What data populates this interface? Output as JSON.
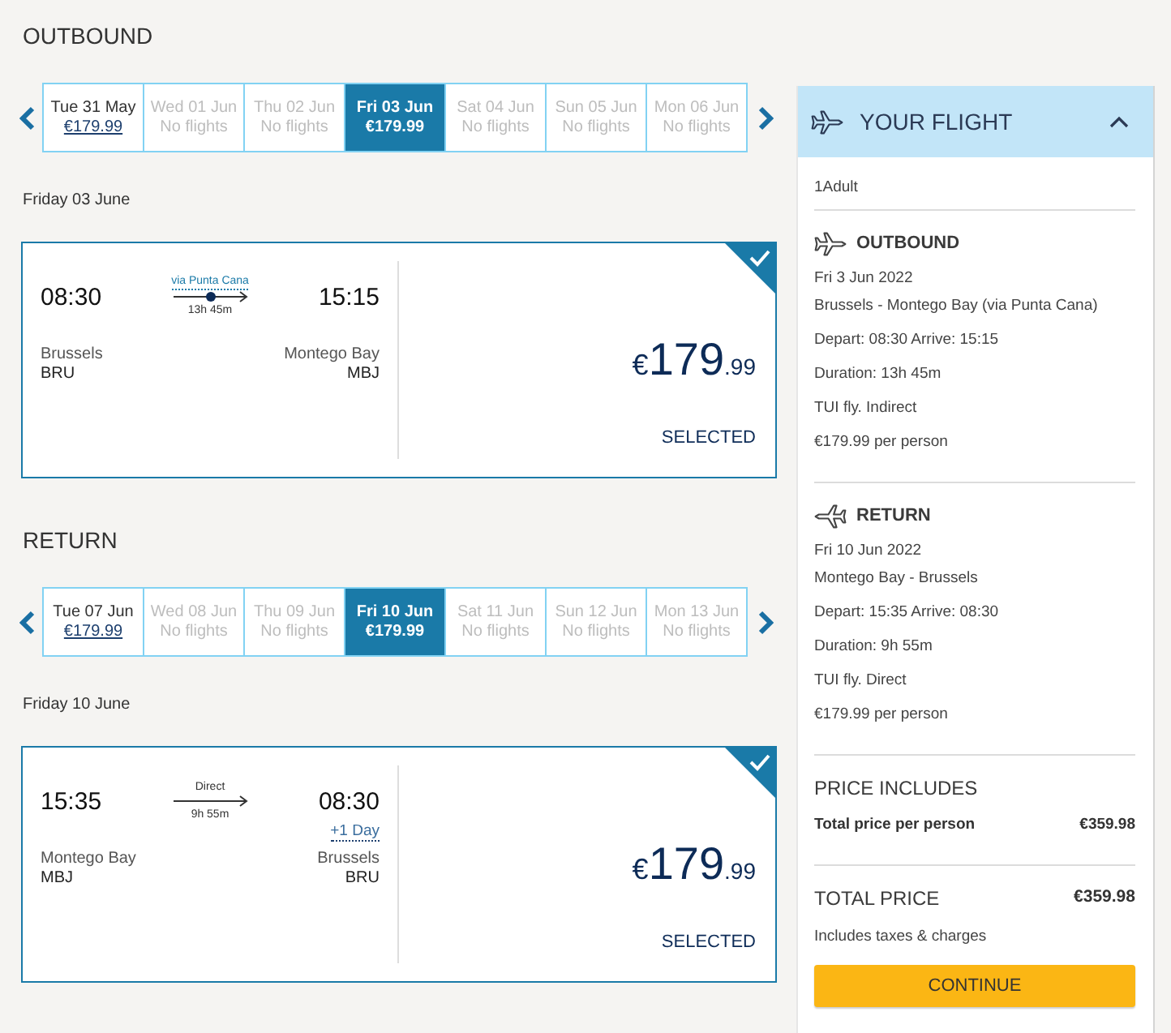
{
  "sections": [
    {
      "title": "OUTBOUND",
      "dates": [
        {
          "day": "Tue 31 May",
          "info": "€179.99",
          "available": true,
          "selected": false
        },
        {
          "day": "Wed 01 Jun",
          "info": "No flights",
          "available": false,
          "selected": false
        },
        {
          "day": "Thu 02 Jun",
          "info": "No flights",
          "available": false,
          "selected": false
        },
        {
          "day": "Fri 03 Jun",
          "info": "€179.99",
          "available": true,
          "selected": true
        },
        {
          "day": "Sat 04 Jun",
          "info": "No flights",
          "available": false,
          "selected": false
        },
        {
          "day": "Sun 05 Jun",
          "info": "No flights",
          "available": false,
          "selected": false
        },
        {
          "day": "Mon 06 Jun",
          "info": "No flights",
          "available": false,
          "selected": false
        }
      ],
      "day_heading": "Friday 03 June",
      "flight": {
        "depart_time": "08:30",
        "arrive_time": "15:15",
        "route": {
          "kind": "stop",
          "label": "via Punta Cana",
          "duration": "13h 45m"
        },
        "from_city": "Brussels",
        "from_code": "BRU",
        "to_city": "Montego Bay",
        "to_code": "MBJ",
        "price": {
          "currency": "€",
          "whole": "179",
          "fraction": ".99"
        },
        "status": "SELECTED",
        "selected": true
      }
    },
    {
      "title": "RETURN",
      "dates": [
        {
          "day": "Tue 07 Jun",
          "info": "€179.99",
          "available": true,
          "selected": false
        },
        {
          "day": "Wed 08 Jun",
          "info": "No flights",
          "available": false,
          "selected": false
        },
        {
          "day": "Thu 09 Jun",
          "info": "No flights",
          "available": false,
          "selected": false
        },
        {
          "day": "Fri 10 Jun",
          "info": "€179.99",
          "available": true,
          "selected": true
        },
        {
          "day": "Sat 11 Jun",
          "info": "No flights",
          "available": false,
          "selected": false
        },
        {
          "day": "Sun 12 Jun",
          "info": "No flights",
          "available": false,
          "selected": false
        },
        {
          "day": "Mon 13 Jun",
          "info": "No flights",
          "available": false,
          "selected": false
        }
      ],
      "day_heading": "Friday 10 June",
      "flight": {
        "depart_time": "15:35",
        "arrive_time": "08:30",
        "arrive_note": "+1 Day",
        "route": {
          "kind": "direct",
          "label": "Direct",
          "duration": "9h 55m"
        },
        "from_city": "Montego Bay",
        "from_code": "MBJ",
        "to_city": "Brussels",
        "to_code": "BRU",
        "price": {
          "currency": "€",
          "whole": "179",
          "fraction": ".99"
        },
        "status": "SELECTED",
        "selected": true
      }
    }
  ],
  "summary": {
    "title": "YOUR FLIGHT",
    "expanded": true,
    "passengers": "1Adult",
    "legs": [
      {
        "kind": "outbound",
        "title": "OUTBOUND",
        "date": "Fri 3 Jun 2022",
        "route": "Brussels - Montego Bay (via Punta Cana)",
        "details": [
          "Depart: 08:30 Arrive: 15:15",
          "Duration: 13h 45m",
          "TUI fly. Indirect",
          "€179.99 per person"
        ]
      },
      {
        "kind": "return",
        "title": "RETURN",
        "date": "Fri 10 Jun 2022",
        "route": "Montego Bay - Brussels",
        "details": [
          "Depart: 15:35 Arrive: 08:30",
          "Duration: 9h 55m",
          "TUI fly. Direct",
          "€179.99 per person"
        ]
      }
    ],
    "price_includes": {
      "title": "PRICE INCLUDES",
      "rows": [
        {
          "label": "Total price per person",
          "value": "€359.98"
        }
      ]
    },
    "total": {
      "label": "TOTAL PRICE",
      "value": "€359.98",
      "note": "Includes taxes & charges"
    },
    "button": "CONTINUE"
  }
}
